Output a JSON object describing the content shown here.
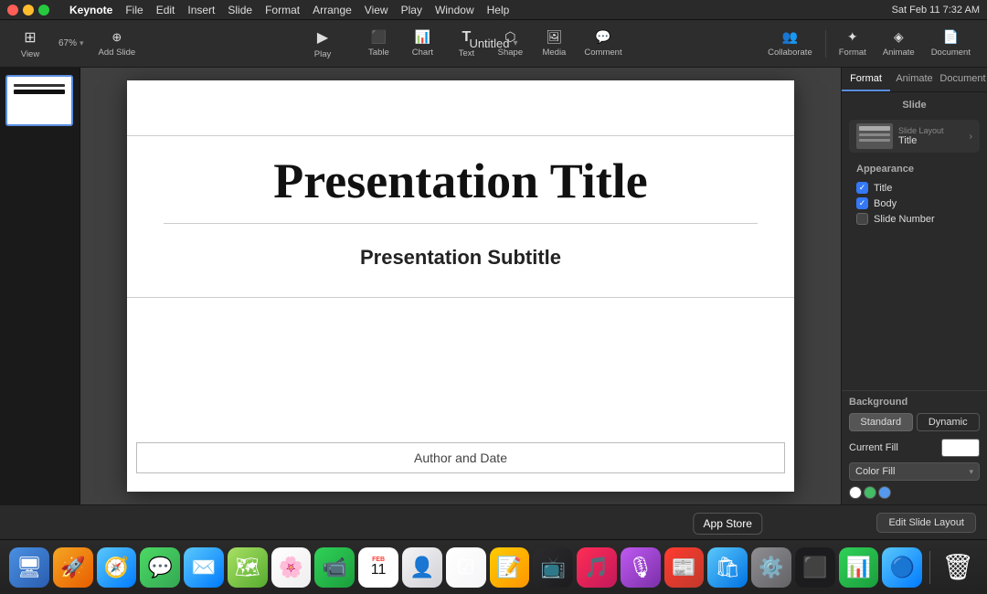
{
  "app": {
    "name": "Keynote",
    "title": "Untitled",
    "time": "Sat Feb 11  7:32 AM"
  },
  "menubar": {
    "menus": [
      "File",
      "Edit",
      "Insert",
      "Slide",
      "Format",
      "Arrange",
      "View",
      "Play",
      "Window",
      "Help"
    ],
    "right_items": [
      "battery_icon",
      "wifi_icon",
      "search_icon",
      "control_icon"
    ]
  },
  "toolbar": {
    "zoom": "67%",
    "buttons": [
      {
        "id": "view",
        "label": "View",
        "icon": "⊞"
      },
      {
        "id": "add-slide",
        "label": "Add Slide",
        "icon": "＋"
      },
      {
        "id": "play",
        "label": "Play",
        "icon": "▶"
      },
      {
        "id": "table",
        "label": "Table",
        "icon": "▦"
      },
      {
        "id": "chart",
        "label": "Chart",
        "icon": "📊"
      },
      {
        "id": "text",
        "label": "Text",
        "icon": "T"
      },
      {
        "id": "shape",
        "label": "Shape",
        "icon": "⬡"
      },
      {
        "id": "media",
        "label": "Media",
        "icon": "🖼"
      },
      {
        "id": "comment",
        "label": "Comment",
        "icon": "💬"
      },
      {
        "id": "collaborate",
        "label": "Collaborate",
        "icon": "👥"
      },
      {
        "id": "format",
        "label": "Format",
        "icon": "✦"
      },
      {
        "id": "animate",
        "label": "Animate",
        "icon": "◈"
      },
      {
        "id": "document",
        "label": "Document",
        "icon": "📄"
      }
    ]
  },
  "slide": {
    "title": "Presentation Title",
    "subtitle": "Presentation Subtitle",
    "footer": "Author and Date"
  },
  "right_panel": {
    "tabs": [
      "Format",
      "Animate",
      "Document"
    ],
    "active_tab": "Format",
    "section_title": "Slide",
    "layout": {
      "label": "Slide Layout",
      "value": "Title"
    },
    "appearance": {
      "title": "Appearance",
      "items": [
        {
          "id": "title",
          "label": "Title",
          "checked": true
        },
        {
          "id": "body",
          "label": "Body",
          "checked": true
        },
        {
          "id": "slide-number",
          "label": "Slide Number",
          "checked": false
        }
      ]
    },
    "background": {
      "title": "Background",
      "buttons": [
        {
          "id": "standard",
          "label": "Standard",
          "active": true
        },
        {
          "id": "dynamic",
          "label": "Dynamic",
          "active": false
        }
      ],
      "current_fill_label": "Current Fill",
      "fill_type": "Color Fill",
      "color_dots": [
        "#ffffff",
        "#44bb66",
        "#5599ee"
      ]
    }
  },
  "bottom_bar": {
    "edit_layout_btn": "Edit Slide Layout"
  },
  "dock": {
    "items": [
      {
        "id": "finder",
        "label": "Finder",
        "color": "#4a90e2",
        "icon": "🖥"
      },
      {
        "id": "launchpad",
        "label": "Launchpad",
        "color": "#f5a623",
        "icon": "🚀"
      },
      {
        "id": "safari",
        "label": "Safari",
        "color": "#5ac8fa",
        "icon": "🧭"
      },
      {
        "id": "messages",
        "label": "Messages",
        "color": "#4cd964",
        "icon": "💬"
      },
      {
        "id": "mail",
        "label": "Mail",
        "color": "#5ac8fa",
        "icon": "✉️"
      },
      {
        "id": "maps",
        "label": "Maps",
        "color": "#30d158",
        "icon": "🗺"
      },
      {
        "id": "photos",
        "label": "Photos",
        "color": "#ff9500",
        "icon": "🌸"
      },
      {
        "id": "facetime",
        "label": "FaceTime",
        "color": "#30d158",
        "icon": "📹"
      },
      {
        "id": "calendar",
        "label": "Calendar",
        "color": "#ff3b30",
        "icon": "📅"
      },
      {
        "id": "contacts",
        "label": "Contacts",
        "color": "#8e8e93",
        "icon": "👤"
      },
      {
        "id": "reminders",
        "label": "Reminders",
        "color": "#ffffff",
        "icon": "☑"
      },
      {
        "id": "notes",
        "label": "Notes",
        "color": "#ffcc00",
        "icon": "📝"
      },
      {
        "id": "appletv",
        "label": "Apple TV",
        "color": "#1c1c1e",
        "icon": "📺"
      },
      {
        "id": "music",
        "label": "Music",
        "color": "#ff2d55",
        "icon": "🎵"
      },
      {
        "id": "podcasts",
        "label": "Podcasts",
        "color": "#bf5af2",
        "icon": "🎙"
      },
      {
        "id": "news",
        "label": "News",
        "color": "#ff3b30",
        "icon": "📰"
      },
      {
        "id": "appstore",
        "label": "App Store",
        "color": "#0071e3",
        "icon": "🛍",
        "tooltip": "App Store"
      },
      {
        "id": "settings",
        "label": "System Preferences",
        "color": "#8e8e93",
        "icon": "⚙️"
      },
      {
        "id": "terminal",
        "label": "Terminal",
        "color": "#1c1c1e",
        "icon": "⬛"
      },
      {
        "id": "activitymonitor",
        "label": "Activity Monitor",
        "color": "#30d158",
        "icon": "📊"
      },
      {
        "id": "finder2",
        "label": "Finder 2",
        "color": "#4a90e2",
        "icon": "🔵"
      },
      {
        "id": "trash",
        "label": "Trash",
        "color": "#8e8e93",
        "icon": "🗑"
      }
    ]
  }
}
